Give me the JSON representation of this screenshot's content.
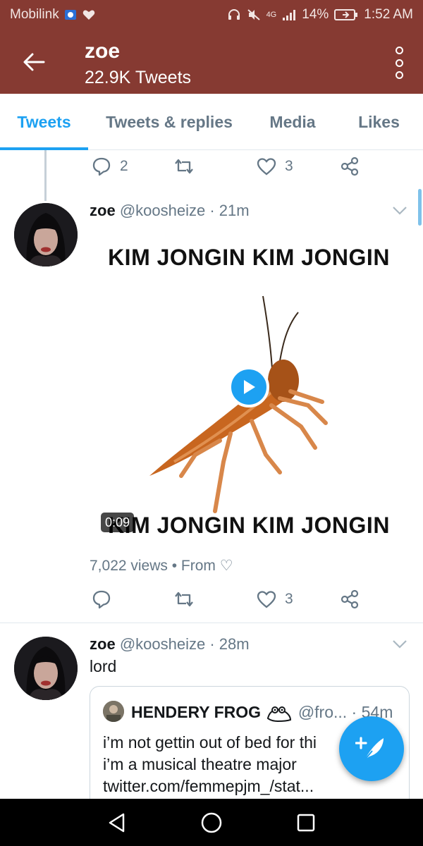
{
  "status_bar": {
    "carrier": "Mobilink",
    "network": "4G",
    "battery": "14%",
    "time": "1:52 AM"
  },
  "header": {
    "title": "zoe",
    "subtitle": "22.9K Tweets"
  },
  "tabs": [
    {
      "label": "Tweets",
      "active": true
    },
    {
      "label": "Tweets & replies",
      "active": false
    },
    {
      "label": "Media",
      "active": false
    },
    {
      "label": "Likes",
      "active": false
    }
  ],
  "thread_actions": {
    "reply_count": "2",
    "like_count": "3"
  },
  "tweet1": {
    "name": "zoe",
    "meta": "@koosheize · 21m",
    "media": {
      "top_text": "KIM JONGIN KIM JONGIN",
      "bottom_text": "KIM JONGIN KIM JONGIN",
      "duration": "0:09"
    },
    "views": "7,022 views • From ♡",
    "like_count": "3"
  },
  "tweet2": {
    "name": "zoe",
    "meta": "@koosheize · 28m",
    "text": "lord",
    "quote": {
      "name": "HENDERY FROG",
      "meta": "@fro... · 54m",
      "lines": [
        "i’m not gettin out of bed for thi",
        "i’m a musical theatre major",
        "twitter.com/femmepjm_/stat..."
      ]
    }
  },
  "colors": {
    "header_bg": "#863a32",
    "accent": "#1da1f2",
    "secondary_text": "#657786",
    "primary_text": "#14171a"
  },
  "icons": {
    "back": "arrow-left-icon",
    "more": "more-vertical-icon",
    "reply": "reply-icon",
    "retweet": "retweet-icon",
    "like": "heart-icon",
    "share": "share-icon",
    "play": "play-icon",
    "compose": "compose-tweet-icon",
    "nav_back": "triangle-back-icon",
    "nav_home": "circle-home-icon",
    "nav_recent": "square-recents-icon"
  }
}
